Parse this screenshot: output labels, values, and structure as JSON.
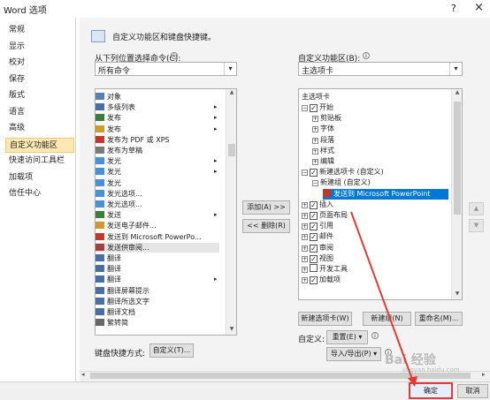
{
  "window": {
    "title": "Word 选项",
    "help": "?",
    "close": "×"
  },
  "sidebar": {
    "items": [
      "常规",
      "显示",
      "校对",
      "保存",
      "版式",
      "语言",
      "高级",
      "自定义功能区",
      "快速访问工具栏",
      "加载项",
      "信任中心"
    ],
    "selected_index": 7
  },
  "header": {
    "description": "自定义功能区和键盘快捷键。"
  },
  "left_panel": {
    "label": "从下列位置选择命令(C):",
    "combo_value": "所有命令",
    "commands": [
      "对象",
      "多级列表",
      "发布",
      "发布",
      "发布为 PDF 或 XPS",
      "发布为草稿",
      "发光",
      "发光",
      "发光",
      "发光选项...",
      "发光选项...",
      "发送",
      "发送电子邮件...",
      "发送到 Microsoft PowerPo...",
      "发送供审阅...",
      "翻译",
      "翻译",
      "翻译",
      "翻译屏幕提示",
      "翻译所选文字",
      "翻译文档",
      "繁转简"
    ],
    "has_submenu": [
      false,
      true,
      true,
      true,
      false,
      false,
      true,
      true,
      false,
      false,
      false,
      true,
      false,
      false,
      false,
      false,
      false,
      true,
      false,
      false,
      false,
      false
    ],
    "highlighted_index": 14
  },
  "mid_buttons": {
    "add": "添加(A) >>",
    "remove": "<< 删除(R)"
  },
  "right_panel": {
    "label": "自定义功能区(B):",
    "combo_value": "主选项卡",
    "tree_header": "主选项卡",
    "tree": [
      {
        "text": "开始",
        "indent": 0,
        "expander": "⊟",
        "checkbox": true
      },
      {
        "text": "剪贴板",
        "indent": 2,
        "expander": "⊞",
        "checkbox": false
      },
      {
        "text": "字体",
        "indent": 2,
        "expander": "⊞",
        "checkbox": false
      },
      {
        "text": "段落",
        "indent": 2,
        "expander": "⊞",
        "checkbox": false
      },
      {
        "text": "样式",
        "indent": 2,
        "expander": "⊞",
        "checkbox": false
      },
      {
        "text": "编辑",
        "indent": 2,
        "expander": "⊞",
        "checkbox": false
      },
      {
        "text": "新建选项卡 (自定义)",
        "indent": 0,
        "expander": "⊟",
        "checkbox": true
      },
      {
        "text": "新建组 (自定义)",
        "indent": 2,
        "expander": "⊟",
        "checkbox": false
      },
      {
        "text": "发送到 Microsoft PowerPoint",
        "indent": 4,
        "expander": "",
        "checkbox": false,
        "selected": true
      },
      {
        "text": "插入",
        "indent": 0,
        "expander": "⊞",
        "checkbox": true
      },
      {
        "text": "页面布局",
        "indent": 0,
        "expander": "⊞",
        "checkbox": true
      },
      {
        "text": "引用",
        "indent": 0,
        "expander": "⊞",
        "checkbox": true
      },
      {
        "text": "邮件",
        "indent": 0,
        "expander": "⊞",
        "checkbox": true
      },
      {
        "text": "审阅",
        "indent": 0,
        "expander": "⊞",
        "checkbox": true
      },
      {
        "text": "视图",
        "indent": 0,
        "expander": "⊞",
        "checkbox": true
      },
      {
        "text": "开发工具",
        "indent": 0,
        "expander": "⊞",
        "checkbox": false
      },
      {
        "text": "加载项",
        "indent": 0,
        "expander": "⊞",
        "checkbox": true
      }
    ],
    "new_tab": "新建选项卡(W)",
    "new_group": "新建组(N)",
    "rename": "重命名(M)...",
    "customize_label": "自定义:",
    "reset": "重置(E) ▾",
    "import_export": "导入/导出(P) ▾"
  },
  "keyboard": {
    "label": "键盘快捷方式:",
    "button": "自定义(T)..."
  },
  "footer": {
    "ok": "确定",
    "cancel": "取消"
  },
  "watermark": {
    "text": "Bai 经验",
    "sub": "jingyan.baidu.com"
  },
  "colors": {
    "selected_nav": "#fce8b2",
    "tree_selection": "#0078d7",
    "highlight_arrow": "#e53935"
  }
}
